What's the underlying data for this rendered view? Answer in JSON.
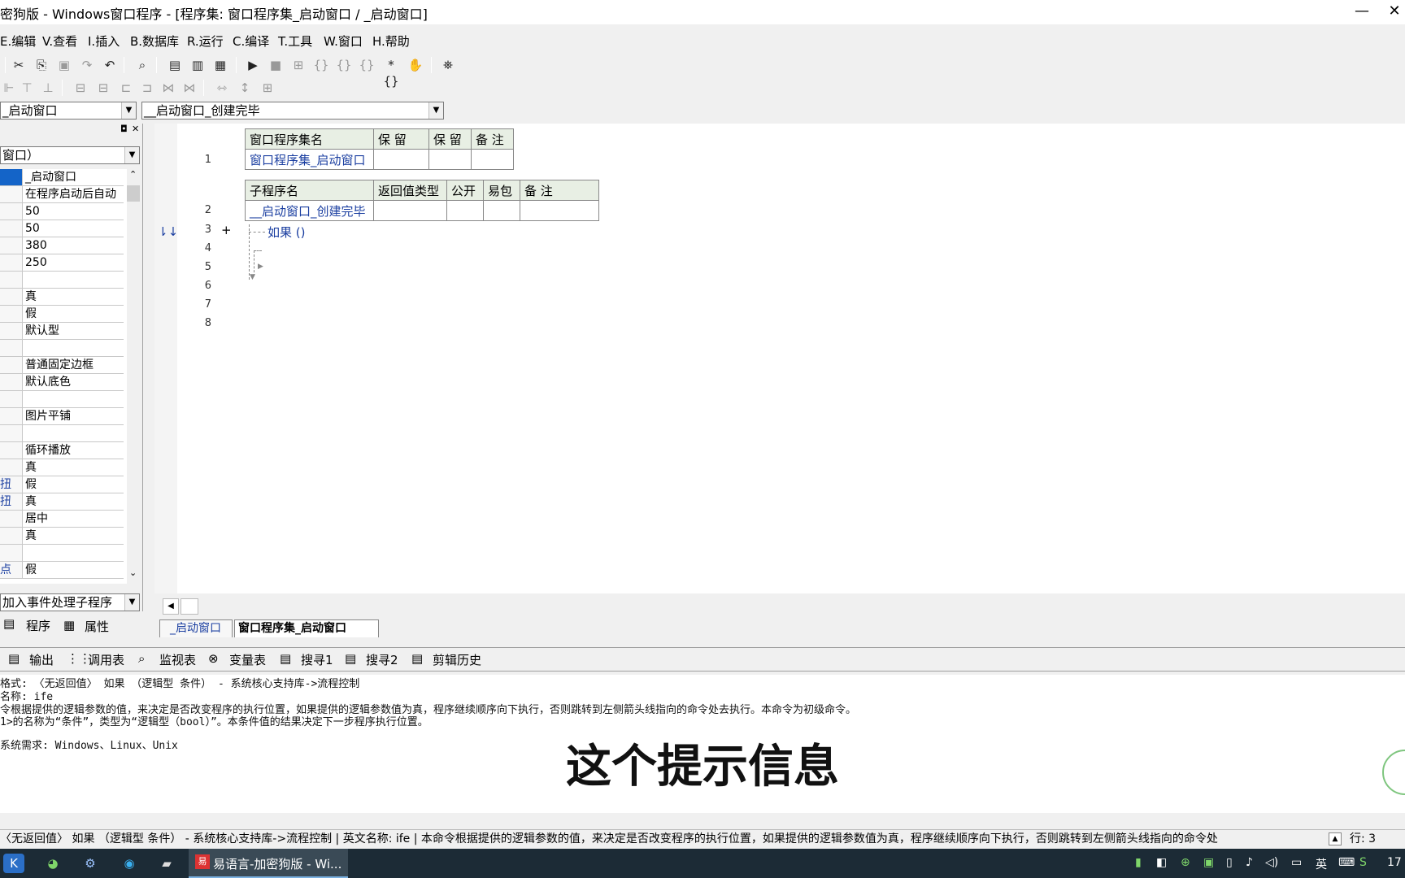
{
  "window": {
    "title": "密狗版 - Windows窗口程序 - [程序集: 窗口程序集_启动窗口 / _启动窗口]",
    "minimize": "—",
    "close": "✕"
  },
  "menu": [
    "E.编辑",
    "V.查看",
    "I.插入",
    "B.数据库",
    "R.运行",
    "C.编译",
    "T.工具",
    "W.窗口",
    "H.帮助"
  ],
  "combos": {
    "left": "_启动窗口",
    "right": "__启动窗口_创建完毕",
    "prop_top": "窗口）",
    "prop_bottom": "加入事件处理子程序"
  },
  "properties": [
    {
      "k": "",
      "v": "_启动窗口"
    },
    {
      "k": "",
      "v": "在程序启动后自动"
    },
    {
      "k": "",
      "v": "50"
    },
    {
      "k": "",
      "v": "50"
    },
    {
      "k": "",
      "v": "380"
    },
    {
      "k": "",
      "v": "250"
    },
    {
      "k": "",
      "v": ""
    },
    {
      "k": "",
      "v": "真"
    },
    {
      "k": "",
      "v": "假"
    },
    {
      "k": "",
      "v": "默认型"
    },
    {
      "k": "",
      "v": ""
    },
    {
      "k": "",
      "v": "普通固定边框"
    },
    {
      "k": "",
      "v": "默认底色"
    },
    {
      "k": "",
      "v": ""
    },
    {
      "k": "",
      "v": "图片平铺"
    },
    {
      "k": "",
      "v": ""
    },
    {
      "k": "",
      "v": "循环播放"
    },
    {
      "k": "",
      "v": "真"
    },
    {
      "k": "扭",
      "v": "假"
    },
    {
      "k": "扭",
      "v": "真"
    },
    {
      "k": "",
      "v": "居中"
    },
    {
      "k": "",
      "v": "真"
    },
    {
      "k": "",
      "v": ""
    },
    {
      "k": "点",
      "v": "假"
    }
  ],
  "panel_tabs": {
    "program": "程序",
    "props": "属性"
  },
  "table1": {
    "headers": [
      "窗口程序集名",
      "保 留",
      "保 留",
      "备 注"
    ],
    "row": [
      "窗口程序集_启动窗口",
      "",
      "",
      ""
    ]
  },
  "table2": {
    "headers": [
      "子程序名",
      "返回值类型",
      "公开",
      "易包",
      "备 注"
    ],
    "row": [
      "__启动窗口_创建完毕",
      "",
      "",
      "",
      ""
    ]
  },
  "line_numbers": [
    "1",
    "2",
    "3",
    "4",
    "5",
    "6",
    "7",
    "8"
  ],
  "code_line": "如果 ()",
  "plus": "+",
  "editor_tabs": [
    "_启动窗口",
    "窗口程序集_启动窗口"
  ],
  "bottom_tabs": [
    "输出",
    "调用表",
    "监视表",
    "变量表",
    "搜寻1",
    "搜寻2",
    "剪辑历史"
  ],
  "output": [
    "格式: 〈无返回值〉 如果 （逻辑型 条件） - 系统核心支持库->流程控制",
    "名称: ife",
    "令根据提供的逻辑参数的值，来决定是否改变程序的执行位置，如果提供的逻辑参数值为真，程序继续顺序向下执行，否则跳转到左侧箭头线指向的命令处去执行。本命令为初级命令。",
    "1>的名称为“条件”，类型为“逻辑型（bool）”。本条件值的结果决定下一步程序执行位置。",
    "系统需求: Windows、Linux、Unix"
  ],
  "subtitle": "这个提示信息",
  "status": {
    "text": "〈无返回值〉 如果 （逻辑型 条件） - 系统核心支持库->流程控制  |  英文名称: ife  |  本命令根据提供的逻辑参数的值，来决定是否改变程序的执行位置，如果提供的逻辑参数值为真，程序继续顺序向下执行，否则跳转到左侧箭头线指向的命令处",
    "row": "行: 3"
  },
  "taskbar": {
    "app": "易语言-加密狗版 - Wi...",
    "ime": "英",
    "clock": "17"
  }
}
